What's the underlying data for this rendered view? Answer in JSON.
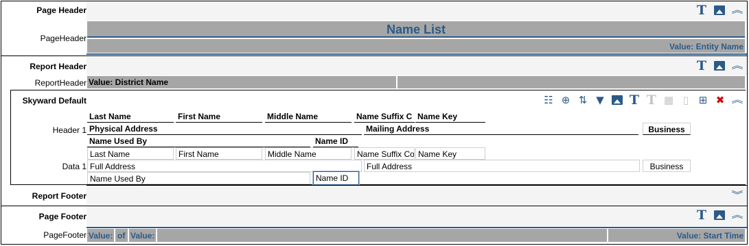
{
  "sections": {
    "page_header": {
      "label": "Page Header",
      "sub_label": "PageHeader",
      "title": "Name List",
      "value_right": "Value: Entity Name"
    },
    "report_header": {
      "label": "Report Header",
      "sub_label": "ReportHeader",
      "value_left": "Value: District Name"
    },
    "group": {
      "label": "Skyward Default",
      "header_label": "Header 1",
      "data_label": "Data 1"
    },
    "report_footer": {
      "label": "Report Footer"
    },
    "page_footer": {
      "label": "Page Footer",
      "sub_label": "PageFooter",
      "value_1": "Value:",
      "of_text": "of",
      "value_2": "Value:",
      "value_right": "Value: Start Time"
    }
  },
  "header_fields": {
    "row1": [
      "Last Name",
      "First Name",
      "Middle Name",
      "Name Suffix C",
      "Name Key"
    ],
    "row2": [
      "Physical Address",
      "Mailing Address",
      "Business"
    ],
    "row3": [
      "Name Used By",
      "Name ID"
    ]
  },
  "data_fields": {
    "row1": [
      "Last Name",
      "First Name",
      "Middle Name",
      "Name Suffix Co",
      "Name Key"
    ],
    "row2": [
      "Full Address",
      "Full Address",
      "Business"
    ],
    "row3": [
      "Name Used By",
      "Name ID"
    ]
  },
  "icons": {
    "text": "T",
    "image": "image-icon",
    "collapse": "︽",
    "expand": "︾",
    "group_toolbar": [
      "columns-icon",
      "add-group-icon",
      "sort-icon",
      "filter-icon",
      "image-icon",
      "text-icon",
      "text-disabled-icon",
      "calculator-icon",
      "page-icon",
      "add-page-icon",
      "delete-icon",
      "collapse-icon"
    ]
  },
  "colors": {
    "accent": "#2c5a88",
    "gray_bar": "#a6a6a6",
    "delete": "#d00000"
  }
}
